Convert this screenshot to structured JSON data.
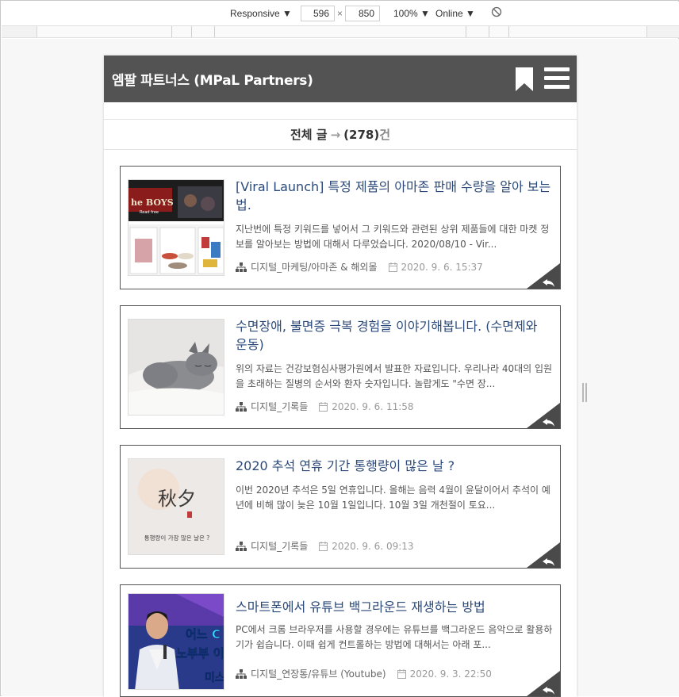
{
  "devtools": {
    "device": "Responsive",
    "width": "596",
    "height": "850",
    "zoom": "100%",
    "network": "Online"
  },
  "header": {
    "title": "엠팔 파트너스 (MPaL Partners)"
  },
  "summary": {
    "label": "전체 글",
    "arrow": "→",
    "count": "(278)",
    "unit": "건"
  },
  "posts": [
    {
      "title": "[Viral Launch] 특정 제품의 아마존 판매 수량을 알아 보는 법.",
      "excerpt": "지난번에 특정 키워드를 넣어서 그 키워드와 관련된 상위 제품들에 대한 마켓 정보를 알아보는 방법에 대해서 다루었습니다. 2020/08/10 - Vir...",
      "category": "디지털_마케팅/아마존 & 해외몰",
      "date": "2020. 9. 6. 15:37",
      "thumb": "amazon-page"
    },
    {
      "title": "수면장애, 불면증 극복 경험을 이야기해봅니다. (수면제와 운동)",
      "excerpt": "위의 자료는 건강보험심사평가원에서 발표한 자료입니다. 우리나라 40대의 입원을 초래하는 질병의 순서와 환자 숫자입니다. 놀랍게도 \"수면 장...",
      "category": "디지털_기록들",
      "date": "2020. 9. 6. 11:58",
      "thumb": "sleeping-cat"
    },
    {
      "title": "2020 추석 연휴 기간 통행량이 많은 날 ?",
      "excerpt": "이번 2020년 추석은 5일 연휴입니다. 올해는 음력 4월이 윤달이어서 추석이 예년에 비해 많이 늦은 10월 1일입니다. 10월 3일 개천절이 토요...",
      "category": "디지털_기록들",
      "date": "2020. 9. 6. 09:13",
      "thumb": "chuseok",
      "thumb_text": {
        "main": "秋夕",
        "sub": "통행량이 가장 많은 날은 ?"
      }
    },
    {
      "title": "스마트폰에서 유튜브 백그라운드 재생하는 방법",
      "excerpt": "PC에서 크롬 브라우저를 사용할 경우에는 유튜브를 백그라운드 음악으로 활용하기가 쉽습니다. 이때 쉽게 컨트롤하는 방법에 대해서는 아래 포...",
      "category": "디지털_연장통/유튜브 (Youtube)",
      "date": "2020. 9. 3. 22:50",
      "thumb": "singer-stage",
      "thumb_text": {
        "line1": "어느 C",
        "line2": "노부부 이",
        "line3": "미스"
      }
    }
  ],
  "colors": {
    "header_bg": "#545353",
    "title_link": "#2b4a7a",
    "card_border": "#555555"
  }
}
